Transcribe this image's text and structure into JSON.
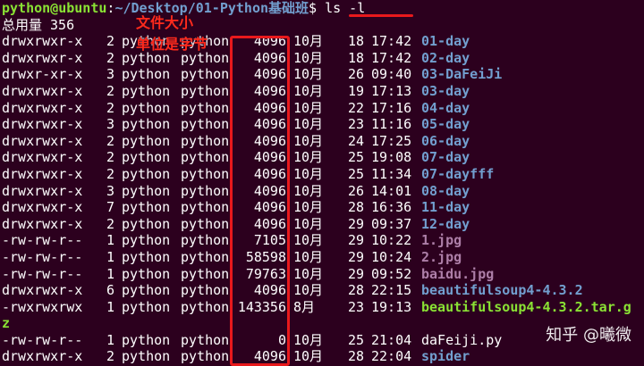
{
  "prompt": {
    "user_host": "python@ubuntu",
    "separator": ":",
    "path": "~/Desktop/01-Python基础班",
    "symbol": "$",
    "command": "ls -l"
  },
  "total_line": "总用量 356",
  "annotations": {
    "line1": "文件大小",
    "line2": "单位是字节"
  },
  "watermark": "知乎 @曦微",
  "colors": {
    "background": "#2c001e",
    "directory": "#729fcf",
    "image_file": "#ad7fa8",
    "archive_file": "#8ae234",
    "annotation_red": "#e8191c"
  },
  "files": [
    {
      "perm": "drwxrwxr-x",
      "links": "2",
      "owner": "python",
      "group": "python",
      "size": "4096",
      "month": "10月",
      "day": "18",
      "time": "17:42",
      "name": "01-day",
      "kind": "dir"
    },
    {
      "perm": "drwxrwxr-x",
      "links": "2",
      "owner": "python",
      "group": "python",
      "size": "4096",
      "month": "10月",
      "day": "18",
      "time": "17:42",
      "name": "02-day",
      "kind": "dir"
    },
    {
      "perm": "drwxr-xr-x",
      "links": "3",
      "owner": "python",
      "group": "python",
      "size": "4096",
      "month": "10月",
      "day": "26",
      "time": "09:40",
      "name": "03-DaFeiJi",
      "kind": "dir"
    },
    {
      "perm": "drwxrwxr-x",
      "links": "2",
      "owner": "python",
      "group": "python",
      "size": "4096",
      "month": "10月",
      "day": "19",
      "time": "17:13",
      "name": "03-day",
      "kind": "dir"
    },
    {
      "perm": "drwxrwxr-x",
      "links": "2",
      "owner": "python",
      "group": "python",
      "size": "4096",
      "month": "10月",
      "day": "22",
      "time": "17:16",
      "name": "04-day",
      "kind": "dir"
    },
    {
      "perm": "drwxrwxr-x",
      "links": "3",
      "owner": "python",
      "group": "python",
      "size": "4096",
      "month": "10月",
      "day": "23",
      "time": "11:16",
      "name": "05-day",
      "kind": "dir"
    },
    {
      "perm": "drwxrwxr-x",
      "links": "2",
      "owner": "python",
      "group": "python",
      "size": "4096",
      "month": "10月",
      "day": "24",
      "time": "17:25",
      "name": "06-day",
      "kind": "dir"
    },
    {
      "perm": "drwxrwxr-x",
      "links": "2",
      "owner": "python",
      "group": "python",
      "size": "4096",
      "month": "10月",
      "day": "25",
      "time": "19:08",
      "name": "07-day",
      "kind": "dir"
    },
    {
      "perm": "drwxrwxr-x",
      "links": "2",
      "owner": "python",
      "group": "python",
      "size": "4096",
      "month": "10月",
      "day": "25",
      "time": "11:34",
      "name": "07-dayfff",
      "kind": "dir"
    },
    {
      "perm": "drwxrwxr-x",
      "links": "3",
      "owner": "python",
      "group": "python",
      "size": "4096",
      "month": "10月",
      "day": "26",
      "time": "14:01",
      "name": "08-day",
      "kind": "dir"
    },
    {
      "perm": "drwxrwxr-x",
      "links": "7",
      "owner": "python",
      "group": "python",
      "size": "4096",
      "month": "10月",
      "day": "28",
      "time": "16:36",
      "name": "11-day",
      "kind": "dir"
    },
    {
      "perm": "drwxrwxr-x",
      "links": "2",
      "owner": "python",
      "group": "python",
      "size": "4096",
      "month": "10月",
      "day": "29",
      "time": "09:37",
      "name": "12-day",
      "kind": "dir"
    },
    {
      "perm": "-rw-rw-r--",
      "links": "1",
      "owner": "python",
      "group": "python",
      "size": "7105",
      "month": "10月",
      "day": "29",
      "time": "10:22",
      "name": "1.jpg",
      "kind": "img"
    },
    {
      "perm": "-rw-rw-r--",
      "links": "1",
      "owner": "python",
      "group": "python",
      "size": "58598",
      "month": "10月",
      "day": "29",
      "time": "10:24",
      "name": "2.jpg",
      "kind": "img"
    },
    {
      "perm": "-rw-rw-r--",
      "links": "1",
      "owner": "python",
      "group": "python",
      "size": "79763",
      "month": "10月",
      "day": "29",
      "time": "09:52",
      "name": "baidu.jpg",
      "kind": "img"
    },
    {
      "perm": "drwxrwxr-x",
      "links": "6",
      "owner": "python",
      "group": "python",
      "size": "4096",
      "month": "10月",
      "day": "28",
      "time": "22:15",
      "name": "beautifulsoup4-4.3.2",
      "kind": "dir"
    },
    {
      "perm": "-rwxrwxrwx",
      "links": "1",
      "owner": "python",
      "group": "python",
      "size": "143356",
      "month": "8月",
      "day": "23",
      "time": "19:13",
      "name": "beautifulsoup4-4.3.2.tar.g",
      "kind": "arch"
    },
    {
      "perm": "",
      "links": "",
      "owner": "",
      "group": "",
      "size": "",
      "month": "",
      "day": "",
      "time": "",
      "name": "z",
      "kind": "arch-wrap"
    },
    {
      "perm": "-rw-rw-r--",
      "links": "1",
      "owner": "python",
      "group": "python",
      "size": "0",
      "month": "10月",
      "day": "25",
      "time": "21:04",
      "name": "daFeiji.py",
      "kind": "file"
    },
    {
      "perm": "drwxrwxr-x",
      "links": "2",
      "owner": "python",
      "group": "python",
      "size": "4096",
      "month": "10月",
      "day": "28",
      "time": "22:04",
      "name": "spider",
      "kind": "dir"
    }
  ]
}
